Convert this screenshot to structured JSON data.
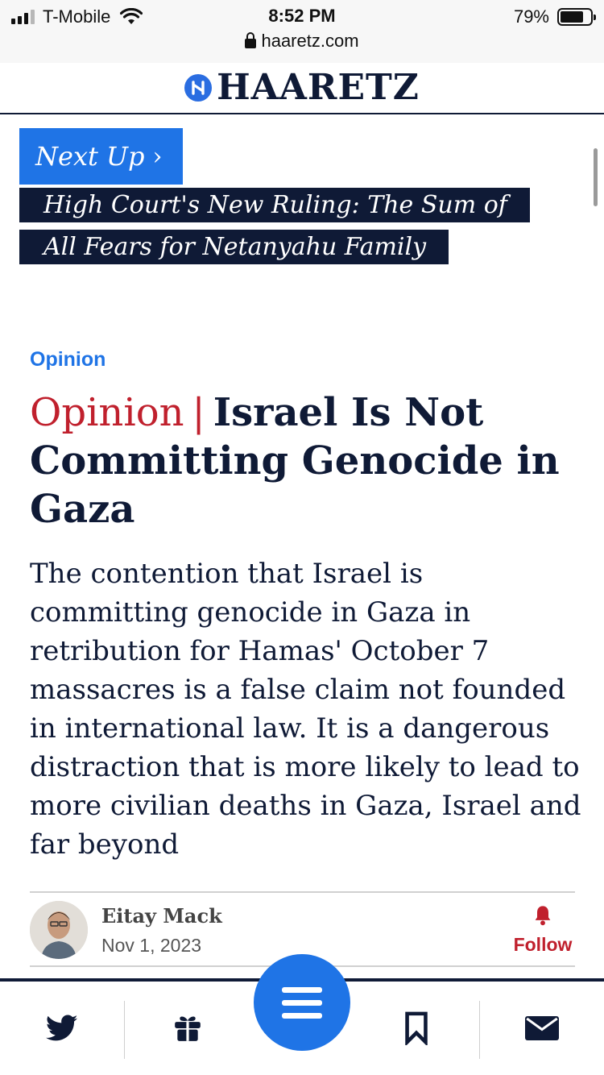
{
  "status_bar": {
    "carrier": "T-Mobile",
    "time": "8:52 PM",
    "battery_percent": "79%",
    "battery_level": 0.79,
    "url": "haaretz.com"
  },
  "masthead": {
    "logo_text": "HAARETZ"
  },
  "next_up": {
    "label": "Next Up",
    "title": "High Court's New Ruling: The Sum of All Fears for Netanyahu Family"
  },
  "article": {
    "section": "Opinion",
    "kicker": "Opinion",
    "separator": "|",
    "headline": "Israel Is Not Committing Genocide in Gaza",
    "dek": "The contention that Israel is committing genocide in Gaza in retribution for Hamas' October 7 massacres is a false claim not founded in international law. It is a dangerous distraction that is more likely to lead to more civilian deaths in Gaza, Israel and far beyond",
    "author": "Eitay Mack",
    "date": "Nov 1, 2023",
    "follow_label": "Follow"
  },
  "toolbar": {
    "items": [
      "twitter-icon",
      "gift-icon",
      "menu-icon",
      "bookmark-icon",
      "mail-icon"
    ]
  },
  "colors": {
    "accent_blue": "#1f74e6",
    "navy": "#0f1a36",
    "red": "#c0202d"
  }
}
